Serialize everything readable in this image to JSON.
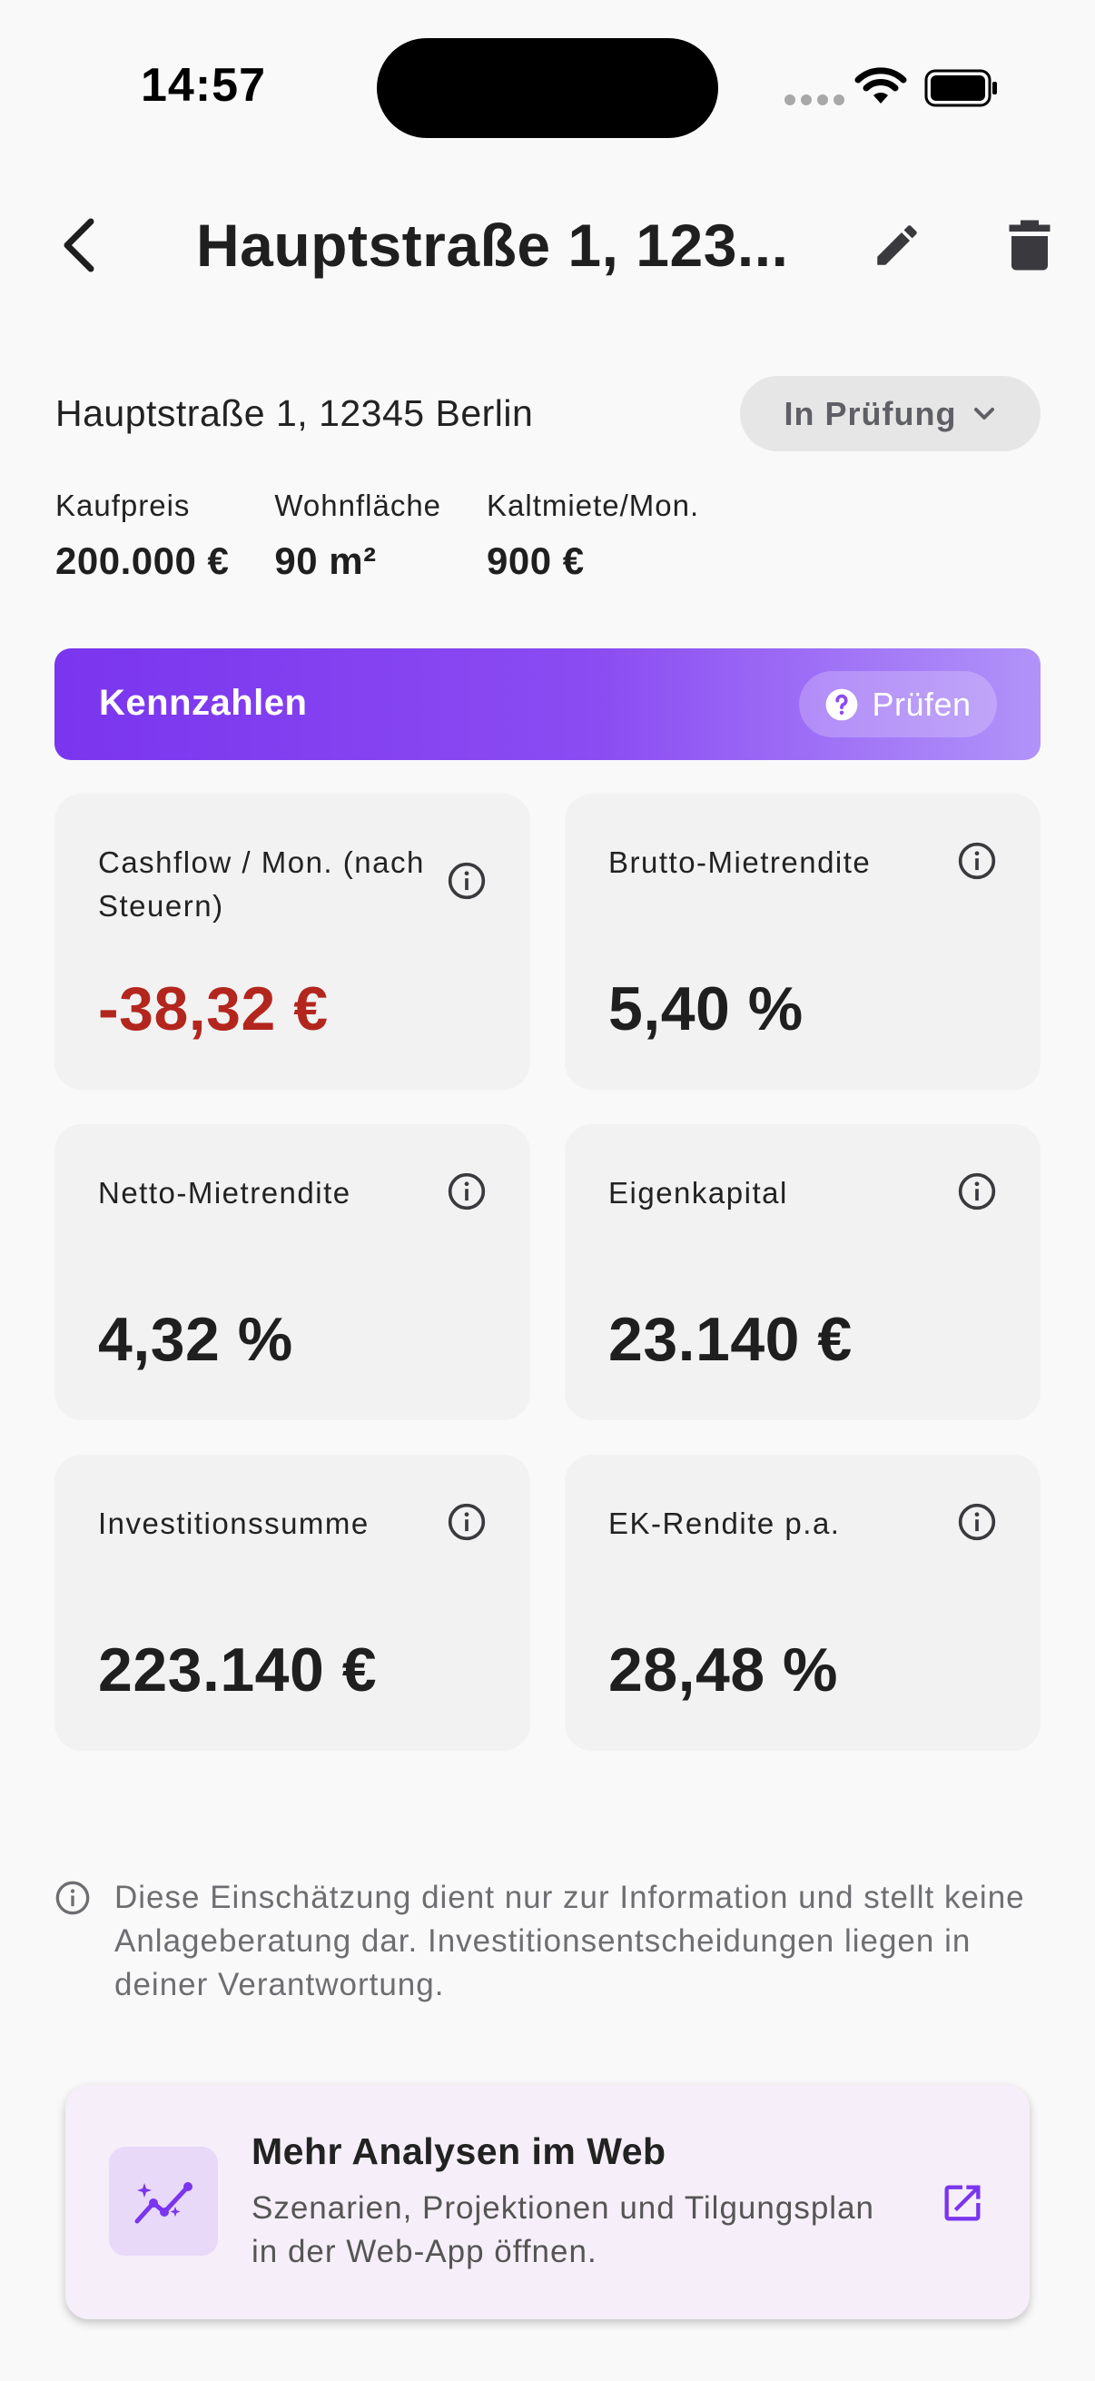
{
  "status_bar": {
    "time": "14:57"
  },
  "app_bar": {
    "title": "Hauptstraße 1, 123..."
  },
  "property": {
    "address": "Hauptstraße 1, 12345 Berlin",
    "status": "In Prüfung",
    "facts": [
      {
        "label": "Kaufpreis",
        "value": "200.000 €"
      },
      {
        "label": "Wohnfläche",
        "value": "90 m²"
      },
      {
        "label": "Kaltmiete/Mon.",
        "value": "900 €"
      }
    ]
  },
  "kennzahlen": {
    "title": "Kennzahlen",
    "check_label": "Prüfen",
    "metrics": [
      {
        "label": "Cashflow / Mon. (nach Steuern)",
        "value": "-38,32 €",
        "negative": true
      },
      {
        "label": "Brutto-Mietrendite",
        "value": "5,40 %"
      },
      {
        "label": "Netto-Mietrendite",
        "value": "4,32 %"
      },
      {
        "label": "Eigenkapital",
        "value": "23.140 €"
      },
      {
        "label": "Investitionssumme",
        "value": "223.140 €"
      },
      {
        "label": "EK-Rendite p.a.",
        "value": "28,48 %"
      }
    ]
  },
  "disclaimer": "Diese Einschätzung dient nur zur Information und stellt keine Anlageberatung dar. Investitionsentscheidungen liegen in deiner Verantwortung.",
  "promo": {
    "title": "Mehr Analysen im Web",
    "subtitle": "Szenarien, Projektionen und Tilgungsplan in der Web-App öffnen."
  },
  "colors": {
    "accent": "#7a35ee",
    "negative": "#b3261e",
    "card_bg": "#f2f2f2"
  },
  "icons": [
    "back-icon",
    "edit-icon",
    "delete-icon",
    "chevron-down-icon",
    "help-icon",
    "info-icon",
    "analytics-icon",
    "open-external-icon"
  ]
}
